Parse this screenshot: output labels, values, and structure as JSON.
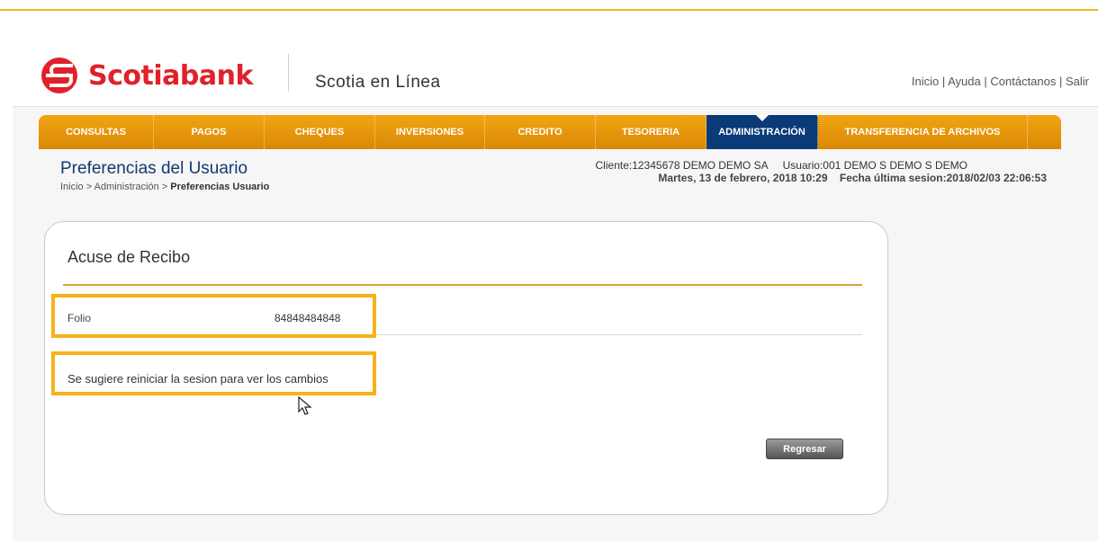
{
  "header": {
    "brand": "Scotiabank",
    "product": "Scotia en Línea",
    "links": [
      "Inicio",
      "Ayuda",
      "Contáctanos",
      "Salir"
    ]
  },
  "nav": {
    "items": [
      "CONSULTAS",
      "PAGOS",
      "CHEQUES",
      "INVERSIONES",
      "CREDITO",
      "TESORERIA",
      "ADMINISTRACIÓN",
      "TRANSFERENCIA DE ARCHIVOS"
    ],
    "active": "ADMINISTRACIÓN"
  },
  "page": {
    "title": "Preferencias del Usuario",
    "breadcrumb_prefix": "Inicio > Administración > ",
    "breadcrumb_current": "Preferencias Usuario"
  },
  "client_info": {
    "line1": "Cliente:12345678 DEMO DEMO SA     Usuario:001 DEMO S DEMO S DEMO",
    "line2": "Martes, 13 de febrero, 2018 10:29    Fecha última sesion:2018/02/03 22:06:53"
  },
  "receipt": {
    "title": "Acuse de Recibo",
    "folio_label": "Folio",
    "folio_value": "84848484848",
    "message": "Se sugiere reiniciar la sesion para ver los cambios",
    "back_button": "Regresar"
  },
  "colors": {
    "brand_red": "#e0212a",
    "nav_orange": "#eb9a0c",
    "nav_active": "#0a3b78",
    "highlight": "#f6b21a"
  }
}
